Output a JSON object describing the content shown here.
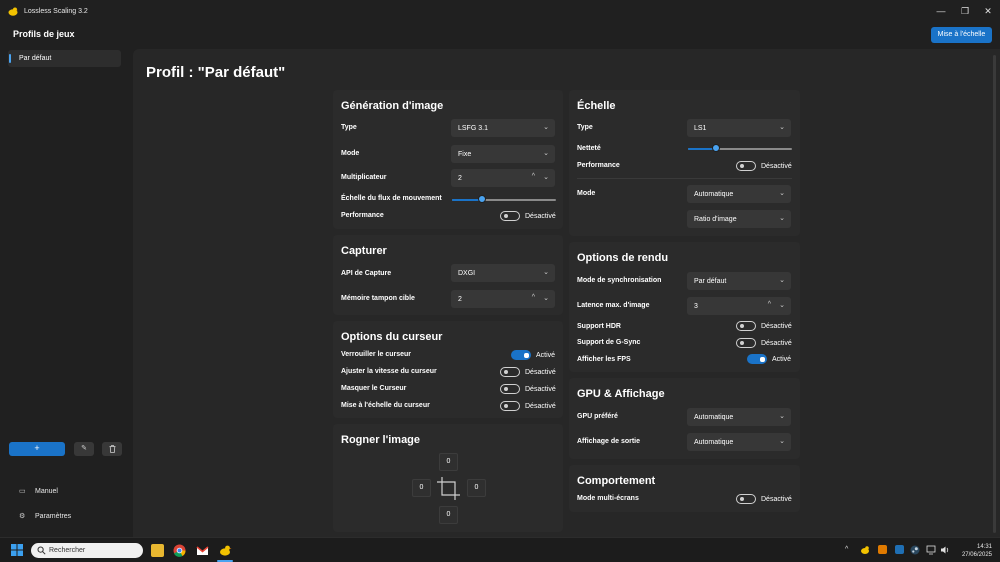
{
  "app": {
    "title": "Lossless Scaling 3.2",
    "header": "Profils de jeux",
    "scale_button": "Mise à l'échelle"
  },
  "window_controls": {
    "minimize": "—",
    "maximize": "❐",
    "close": "✕"
  },
  "sidebar": {
    "items": [
      {
        "label": "Par défaut",
        "selected": true
      }
    ],
    "add_label": "+",
    "bottom": [
      {
        "label": "Manuel",
        "icon": "book-icon"
      },
      {
        "label": "Paramètres",
        "icon": "gear-icon"
      }
    ]
  },
  "page": {
    "title": "Profil : \"Par défaut\""
  },
  "generation": {
    "title": "Génération d'image",
    "type_label": "Type",
    "type_value": "LSFG 3.1",
    "mode_label": "Mode",
    "mode_value": "Fixe",
    "multiplier_label": "Multiplicateur",
    "multiplier_value": "2",
    "flow_scale_label": "Échelle du flux de mouvement",
    "flow_scale_level": 0.29,
    "performance_label": "Performance",
    "performance_state": "Désactivé"
  },
  "capture": {
    "title": "Capturer",
    "api_label": "API de Capture",
    "api_value": "DXGI",
    "buffer_label": "Mémoire tampon cible",
    "buffer_value": "2"
  },
  "cursor": {
    "title": "Options du curseur",
    "rows": [
      {
        "label": "Verrouiller le curseur",
        "state": "Activé",
        "on": true
      },
      {
        "label": "Ajuster la vitesse du curseur",
        "state": "Désactivé",
        "on": false
      },
      {
        "label": "Masquer le Curseur",
        "state": "Désactivé",
        "on": false
      },
      {
        "label": "Mise à l'échelle du curseur",
        "state": "Désactivé",
        "on": false
      }
    ]
  },
  "crop": {
    "title": "Rogner l'image",
    "top": "0",
    "left": "0",
    "right": "0",
    "bottom": "0"
  },
  "scaling": {
    "title": "Échelle",
    "type_label": "Type",
    "type_value": "LS1",
    "sharpness_label": "Netteté",
    "sharpness_level": 0.27,
    "performance_label": "Performance",
    "performance_state": "Désactivé",
    "mode_label": "Mode",
    "mode_value": "Automatique",
    "ratio_value": "Ratio d'image"
  },
  "render": {
    "title": "Options de rendu",
    "sync_label": "Mode de synchronisation",
    "sync_value": "Par défaut",
    "latency_label": "Latence max. d'image",
    "latency_value": "3",
    "hdr_label": "Support HDR",
    "hdr_state": "Désactivé",
    "gsync_label": "Support de G-Sync",
    "gsync_state": "Désactivé",
    "fps_label": "Afficher les FPS",
    "fps_state": "Activé"
  },
  "gpu": {
    "title": "GPU & Affichage",
    "gpu_label": "GPU préféré",
    "gpu_value": "Automatique",
    "output_label": "Affichage de sortie",
    "output_value": "Automatique"
  },
  "behavior": {
    "title": "Comportement",
    "multi_label": "Mode multi-écrans",
    "multi_state": "Désactivé"
  },
  "taskbar": {
    "search_placeholder": "Rechercher",
    "time": "14:31",
    "date": "27/06/2025"
  },
  "colors": {
    "accent": "#1a73c8",
    "background": "#202020",
    "card": "#2b2b2b"
  }
}
